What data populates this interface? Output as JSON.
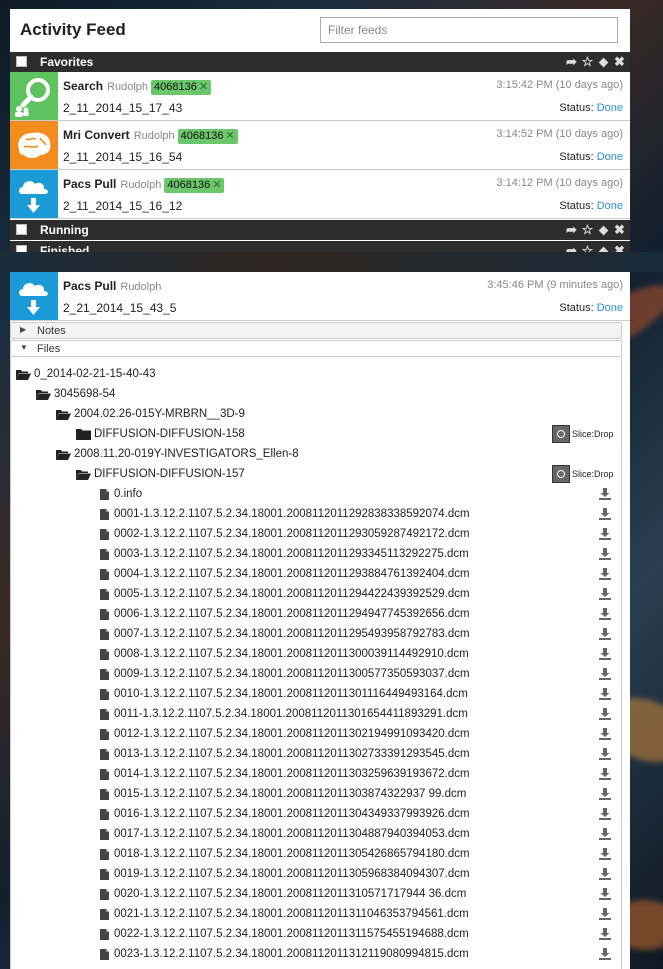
{
  "header": {
    "title": "Activity Feed",
    "filter_placeholder": "Filter feeds"
  },
  "categories": [
    {
      "label": "Favorites"
    },
    {
      "label": "Running"
    },
    {
      "label": "Finished"
    }
  ],
  "favorites": [
    {
      "type": "Search",
      "user": "Rudolph",
      "tag": "4068136",
      "time": "3:15:42 PM (10 days ago)",
      "name": "2_11_2014_15_17_43",
      "status_label": "Status:",
      "status": "Done",
      "icon": "search-icon",
      "color": "#5ec35e"
    },
    {
      "type": "Mri Convert",
      "user": "Rudolph",
      "tag": "4068136",
      "time": "3:14:52 PM (10 days ago)",
      "name": "2_11_2014_15_16_54",
      "status_label": "Status:",
      "status": "Done",
      "icon": "brain-icon",
      "color": "#f28c1f"
    },
    {
      "type": "Pacs Pull",
      "user": "Rudolph",
      "tag": "4068136",
      "time": "3:14:12 PM (10 days ago)",
      "name": "2_11_2014_15_16_12",
      "status_label": "Status:",
      "status": "Done",
      "icon": "cloud-download-icon",
      "color": "#1a9ad6"
    }
  ],
  "finished_feed": {
    "type": "Pacs Pull",
    "user": "Rudolph",
    "time": "3:45:46 PM (9 minutes ago)",
    "name": "2_21_2014_15_43_5",
    "status_label": "Status:",
    "status": "Done",
    "icon": "cloud-download-icon",
    "color": "#1a9ad6"
  },
  "panels": {
    "notes": "Notes",
    "files": "Files"
  },
  "slicedrop": "Slice:Drop",
  "tree": {
    "root": "0_2014-02-21-15-40-43",
    "patient": "3045698-54",
    "study1": "2004.02.26-015Y-MRBRN__3D-9",
    "series1": "DIFFUSION-DIFFUSION-158",
    "study2": "2008.11.20-019Y-INVESTIGATORS_Ellen-8",
    "series2": "DIFFUSION-DIFFUSION-157",
    "files": [
      "0.info",
      "0001-1.3.12.2.1107.5.2.34.18001.2008112011292838338592074.dcm",
      "0002-1.3.12.2.1107.5.2.34.18001.2008112011293059287492172.dcm",
      "0003-1.3.12.2.1107.5.2.34.18001.2008112011293345113292275.dcm",
      "0004-1.3.12.2.1107.5.2.34.18001.2008112011293884761392404.dcm",
      "0005-1.3.12.2.1107.5.2.34.18001.2008112011294422439392529.dcm",
      "0006-1.3.12.2.1107.5.2.34.18001.2008112011294947745392656.dcm",
      "0007-1.3.12.2.1107.5.2.34.18001.2008112011295493958792783.dcm",
      "0008-1.3.12.2.1107.5.2.34.18001.2008112011300039114492910.dcm",
      "0009-1.3.12.2.1107.5.2.34.18001.2008112011300577350593037.dcm",
      "0010-1.3.12.2.1107.5.2.34.18001.2008112011301116449493164.dcm",
      "0011-1.3.12.2.1107.5.2.34.18001.2008112011301654411893291.dcm",
      "0012-1.3.12.2.1107.5.2.34.18001.2008112011302194991093420.dcm",
      "0013-1.3.12.2.1107.5.2.34.18001.2008112011302733391293545.dcm",
      "0014-1.3.12.2.1107.5.2.34.18001.2008112011303259639193672.dcm",
      "0015-1.3.12.2.1107.5.2.34.18001.2008112011303874322937 99.dcm",
      "0016-1.3.12.2.1107.5.2.34.18001.2008112011304349337993926.dcm",
      "0017-1.3.12.2.1107.5.2.34.18001.2008112011304887940394053.dcm",
      "0018-1.3.12.2.1107.5.2.34.18001.2008112011305426865794180.dcm",
      "0019-1.3.12.2.1107.5.2.34.18001.2008112011305968384094307.dcm",
      "0020-1.3.12.2.1107.5.2.34.18001.2008112011310571717944 36.dcm",
      "0021-1.3.12.2.1107.5.2.34.18001.2008112011311046353794561.dcm",
      "0022-1.3.12.2.1107.5.2.34.18001.2008112011311575455194688.dcm",
      "0023-1.3.12.2.1107.5.2.34.18001.2008112011312119080994815.dcm"
    ]
  }
}
